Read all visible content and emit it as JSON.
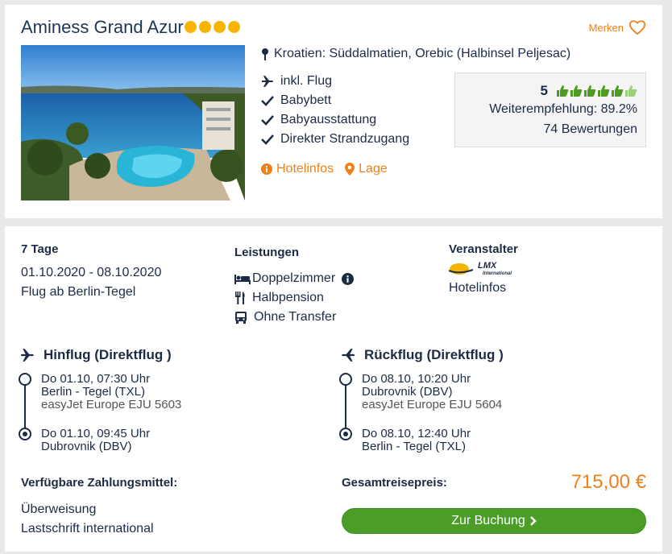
{
  "hotel": {
    "name": "Aminess Grand Azur",
    "merken_label": "Merken",
    "location": "Kroatien: Süddalmatien, Orebic (Halbinsel Peljesac)",
    "features": [
      "inkl. Flug",
      "Babybett",
      "Babyausstattung",
      "Direkter Strandzugang"
    ],
    "links": {
      "info": "Hotelinfos",
      "lage": "Lage"
    },
    "star_rating": 4,
    "rating": {
      "score": "5",
      "thumbs_total": 6,
      "recommendation": "Weiterempfehlung: 89.2%",
      "reviews": "74 Bewertungen"
    }
  },
  "offer": {
    "duration": "7 Tage",
    "dates": "01.10.2020 - 08.10.2020",
    "departure": "Flug ab Berlin-Tegel",
    "services_title": "Leistungen",
    "services": [
      "Doppelzimmer",
      "Halbpension",
      "Ohne Transfer"
    ],
    "operator_title": "Veranstalter",
    "operator_logo_text": "LMX",
    "operator_logo_sub": "International",
    "operator_link": "Hotelinfos"
  },
  "outbound": {
    "title": "Hinflug (Direktflug )",
    "dep_time": "Do 01.10, 07:30 Uhr",
    "dep_airport": "Berlin - Tegel (TXL)",
    "carrier": "easyJet Europe EJU 5603",
    "arr_time": "Do 01.10, 09:45 Uhr",
    "arr_airport": "Dubrovnik (DBV)"
  },
  "return": {
    "title": "Rückflug (Direktflug )",
    "dep_time": "Do 08.10, 10:20 Uhr",
    "dep_airport": "Dubrovnik (DBV)",
    "carrier": "easyJet Europe EJU 5604",
    "arr_time": "Do 08.10, 12:40 Uhr",
    "arr_airport": "Berlin - Tegel (TXL)"
  },
  "payment": {
    "title": "Verfügbare Zahlungsmittel:",
    "methods": [
      "Überweisung",
      "Lastschrift international"
    ]
  },
  "total": {
    "label": "Gesamtreisepreis:",
    "price": "715,00 €",
    "button": "Zur Buchung"
  },
  "colors": {
    "accent": "#f0801a",
    "primary": "#1c2b45",
    "button": "#4a9e27",
    "thumb": "#4e9a22",
    "thumb_light": "#9bcf7a",
    "star": "#f7b500"
  }
}
